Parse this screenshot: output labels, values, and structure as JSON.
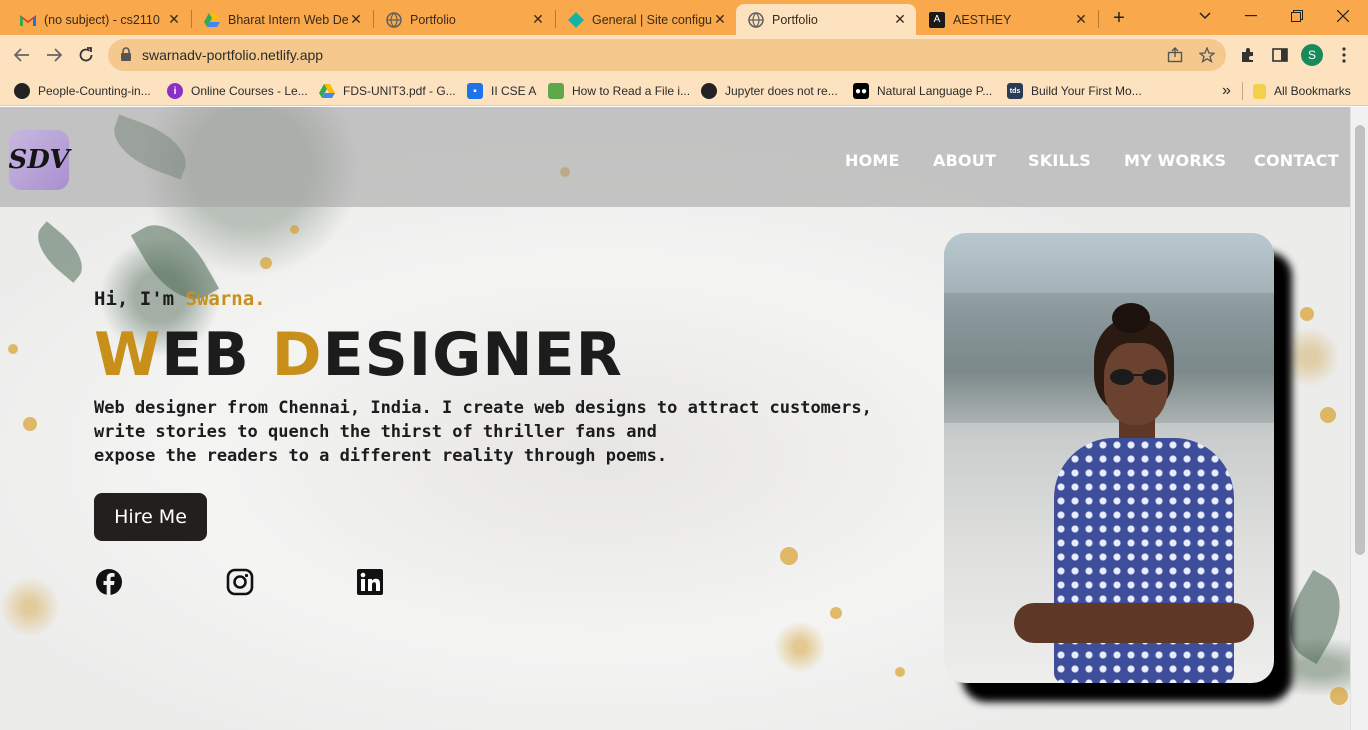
{
  "browser": {
    "tabs": [
      {
        "title": "(no subject) - cs2110",
        "icon": "gmail-icon",
        "active": false
      },
      {
        "title": "Bharat Intern Web De",
        "icon": "google-drive-icon",
        "active": false
      },
      {
        "title": "Portfolio",
        "icon": "globe-icon",
        "active": false
      },
      {
        "title": "General | Site configu",
        "icon": "netlify-icon",
        "active": false
      },
      {
        "title": "Portfolio",
        "icon": "globe-icon",
        "active": true
      },
      {
        "title": "AESTHEY",
        "icon": "aesthey-icon",
        "active": false
      }
    ],
    "new_tab": "+",
    "url": "swarnadv-portfolio.netlify.app",
    "profile_initial": "S",
    "bookmarks": [
      {
        "label": "People-Counting-in...",
        "icon": "github-icon"
      },
      {
        "label": "Online Courses - Le...",
        "icon": "udemy-icon"
      },
      {
        "label": "FDS-UNIT3.pdf - G...",
        "icon": "google-drive-icon"
      },
      {
        "label": "II CSE A",
        "icon": "classroom-icon"
      },
      {
        "label": "How to Read a File i...",
        "icon": "leaf-icon"
      },
      {
        "label": "Jupyter does not re...",
        "icon": "github-icon"
      },
      {
        "label": "Natural Language P...",
        "icon": "medium-icon"
      },
      {
        "label": "Build Your First Mo...",
        "icon": "tds-icon"
      }
    ],
    "all_bookmarks": "All Bookmarks",
    "more_bookmarks": "»",
    "colors": {
      "tabstrip": "#f9a94b",
      "toolbar": "#fde2c0"
    }
  },
  "site": {
    "logo": "SDV",
    "nav": [
      "HOME",
      "ABOUT",
      "SKILLS",
      "MY WORKS",
      "CONTACT"
    ],
    "hero": {
      "greeting": "Hi, I'm ",
      "name": "Swarna.",
      "title_w": "W",
      "title_eb": "EB ",
      "title_d": "D",
      "title_esigner": "ESIGNER",
      "desc_line1": "Web designer from Chennai, India. I create web designs to attract customers,",
      "desc_line2": "write stories to quench the thirst of thriller fans and",
      "desc_line3": "expose the readers to a different reality through poems.",
      "button": "Hire Me"
    },
    "social": [
      "facebook-icon",
      "instagram-icon",
      "linkedin-icon"
    ],
    "accent_color": "#c8901a",
    "button_color": "#231f1d"
  }
}
